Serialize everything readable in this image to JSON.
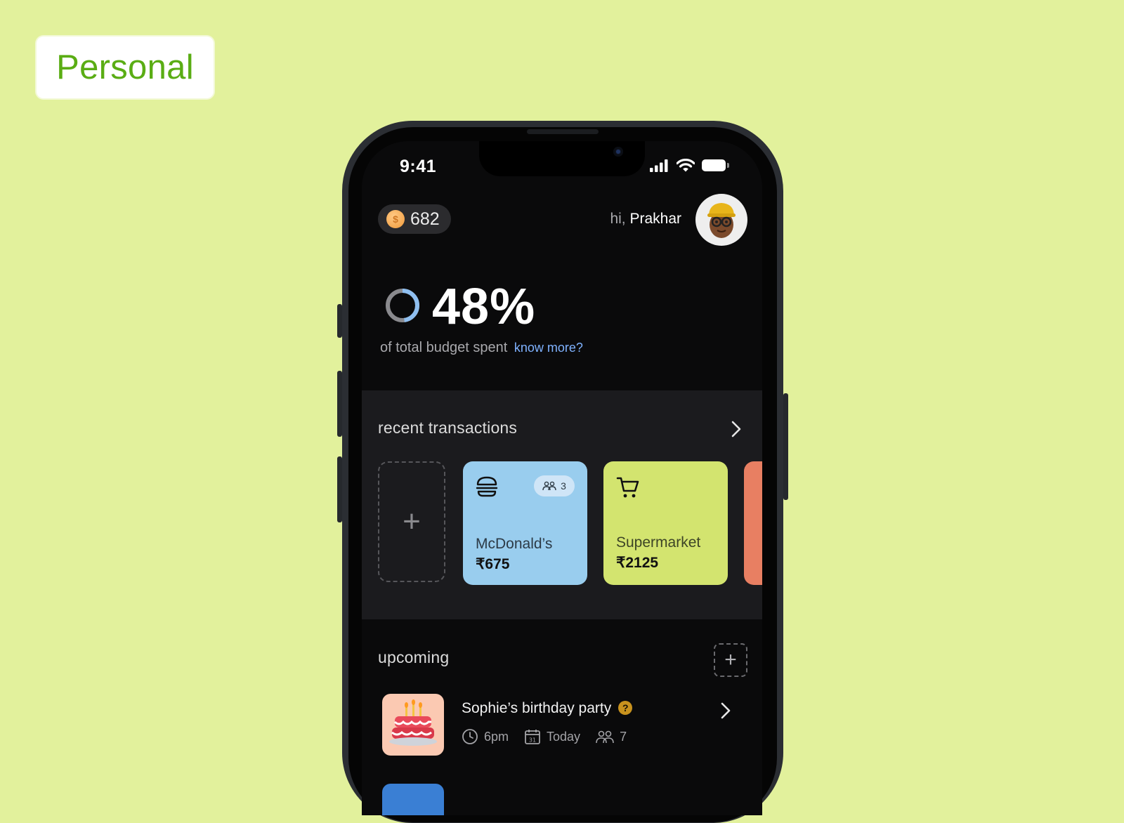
{
  "badge": {
    "label": "Personal"
  },
  "status_bar": {
    "time": "9:41"
  },
  "header": {
    "coins": "682",
    "greeting": "hi,",
    "user_name": "Prakhar"
  },
  "budget": {
    "percent_text": "48%",
    "percent_value": 48,
    "caption": "of total budget spent",
    "link": "know more?"
  },
  "recent": {
    "title": "recent transactions",
    "cards": [
      {
        "merchant": "McDonald’s",
        "amount": "₹675",
        "people": "3",
        "icon": "burger-icon",
        "color": "#99cdee"
      },
      {
        "merchant": "Supermarket",
        "amount": "₹2125",
        "icon": "cart-icon",
        "color": "#d3e46f"
      },
      {
        "color": "#e87f62"
      }
    ]
  },
  "upcoming": {
    "title": "upcoming",
    "events": [
      {
        "title": "Sophie’s birthday party",
        "time": "6pm",
        "date": "Today",
        "people": "7",
        "icon": "birthday-cake-icon"
      }
    ]
  },
  "colors": {
    "background": "#e2f19c",
    "accent_green": "#5aad14",
    "link_blue": "#7fb2ff"
  }
}
